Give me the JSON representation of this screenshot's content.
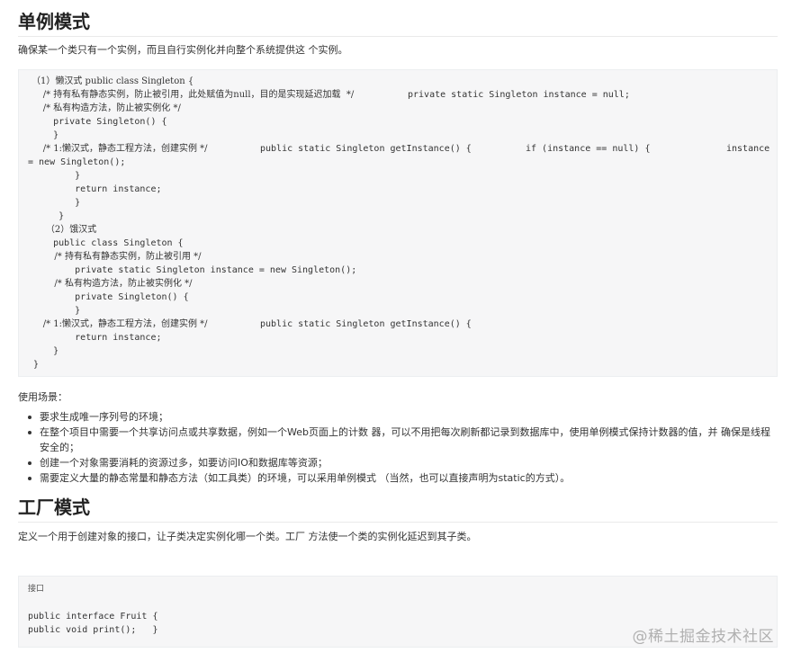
{
  "singleton": {
    "title": "单例模式",
    "intro": "确保某一个类只有一个实例，而且自行实例化并向整个系统提供这 个实例。",
    "code_lines": [
      "（1）懒汉式 public class Singleton {",
      "    /* 持有私有静态实例，防止被引用，此处赋值为null，目的是实现延迟加载  */",
      "private static Singleton instance = null;",
      "    /* 私有构造方法，防止被实例化 */",
      "    private Singleton() {",
      "    }",
      "    /* 1:懒汉式，静态工程方法，创建实例 */",
      "public static Singleton getInstance() {",
      "if (instance == null) {",
      "instance",
      "= new Singleton();",
      "        }",
      "        return instance;",
      "        }",
      "     }",
      "     （2）饿汉式",
      "    public class Singleton {",
      "        /* 持有私有静态实例，防止被引用 */",
      "        private static Singleton instance = new Singleton();",
      "        /* 私有构造方法，防止被实例化 */",
      "        private Singleton() {",
      "        }",
      "    /* 1:懒汉式，静态工程方法，创建实例 */",
      "public static Singleton getInstance() {",
      "        return instance;",
      "    }",
      " }"
    ],
    "usage_title": "使用场景：",
    "usage_items": [
      "要求生成唯一序列号的环境；",
      "在整个项目中需要一个共享访问点或共享数据，例如一个Web页面上的计数 器，可以不用把每次刷新都记录到数据库中，使用单例模式保持计数器的值，并 确保是线程安全的；",
      "创建一个对象需要消耗的资源过多，如要访问IO和数据库等资源；",
      "需要定义大量的静态常量和静态方法（如工具类）的环境，可以采用单例模式 （当然，也可以直接声明为static的方式）。"
    ]
  },
  "factory": {
    "title": "工厂模式",
    "intro": "定义一个用于创建对象的接口，让子类决定实例化哪一个类。工厂 方法使一个类的实例化延迟到其子类。",
    "code_lines": [
      "接口",
      "public interface Fruit {",
      "public void print();   }"
    ]
  },
  "watermark": "@稀土掘金技术社区"
}
